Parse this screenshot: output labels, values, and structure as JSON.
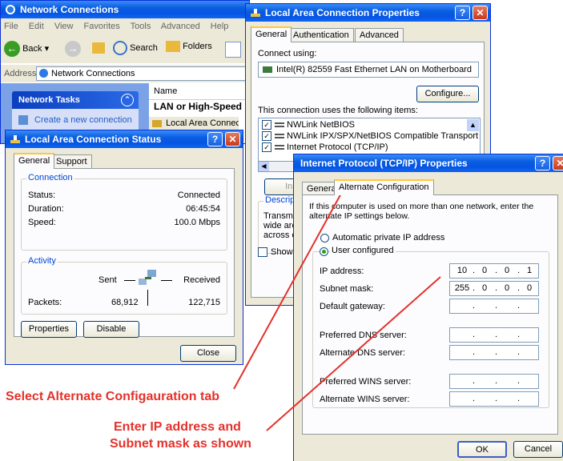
{
  "network_connections": {
    "title": "Network Connections",
    "menu": [
      "File",
      "Edit",
      "View",
      "Favorites",
      "Tools",
      "Advanced",
      "Help"
    ],
    "toolbar": {
      "back": "Back",
      "search": "Search",
      "folders": "Folders"
    },
    "address_label": "Address",
    "address_value": "Network Connections",
    "tasks_title": "Network Tasks",
    "task_create": "Create a new connection",
    "col_name": "Name",
    "group_header": "LAN or High-Speed Inte",
    "item_local": "Local Area Connection"
  },
  "lac_properties": {
    "title": "Local Area Connection Properties",
    "tabs": [
      "General",
      "Authentication",
      "Advanced"
    ],
    "connect_using": "Connect using:",
    "adapter": "Intel(R) 82559 Fast Ethernet LAN on Motherboard",
    "configure": "Configure...",
    "items_label": "This connection uses the following items:",
    "items": [
      "NWLink NetBIOS",
      "NWLink IPX/SPX/NetBIOS Compatible Transport Prot",
      "Internet Protocol (TCP/IP)"
    ],
    "install_partial": "Inst",
    "desc_label": "Descripti",
    "desc_lines": [
      "Transmi",
      "wide are",
      "across c"
    ],
    "show_partial": "Show i"
  },
  "lac_status": {
    "title": "Local Area Connection Status",
    "tabs": [
      "General",
      "Support"
    ],
    "connection_group": "Connection",
    "status_label": "Status:",
    "status_value": "Connected",
    "duration_label": "Duration:",
    "duration_value": "06:45:54",
    "speed_label": "Speed:",
    "speed_value": "100.0 Mbps",
    "activity_group": "Activity",
    "sent": "Sent",
    "received": "Received",
    "packets_label": "Packets:",
    "packets_sent": "68,912",
    "packets_received": "122,715",
    "properties_btn": "Properties",
    "disable_btn": "Disable",
    "close_btn": "Close"
  },
  "tcpip": {
    "title": "Internet Protocol (TCP/IP) Properties",
    "tabs": [
      "General",
      "Alternate Configuration"
    ],
    "info": "If this computer is used on more than one network, enter the alternate IP settings below.",
    "auto_private": "Automatic private IP address",
    "user_configured": "User configured",
    "ip_label": "IP address:",
    "ip_value": [
      "10",
      "0",
      "0",
      "1"
    ],
    "mask_label": "Subnet mask:",
    "mask_value": [
      "255",
      "0",
      "0",
      "0"
    ],
    "gateway_label": "Default gateway:",
    "pref_dns": "Preferred DNS server:",
    "alt_dns": "Alternate DNS server:",
    "pref_wins": "Preferred WINS server:",
    "alt_wins": "Alternate WINS server:",
    "ok": "OK",
    "cancel": "Cancel"
  },
  "annotations": {
    "a1": "Select Alternate Configauration tab",
    "a2_line1": "Enter IP address and",
    "a2_line2": "Subnet mask as shown"
  },
  "colors": {
    "xp_blue": "#0a5ee0",
    "annotation_red": "#e3312b",
    "dialog_bg": "#ece9d8"
  }
}
